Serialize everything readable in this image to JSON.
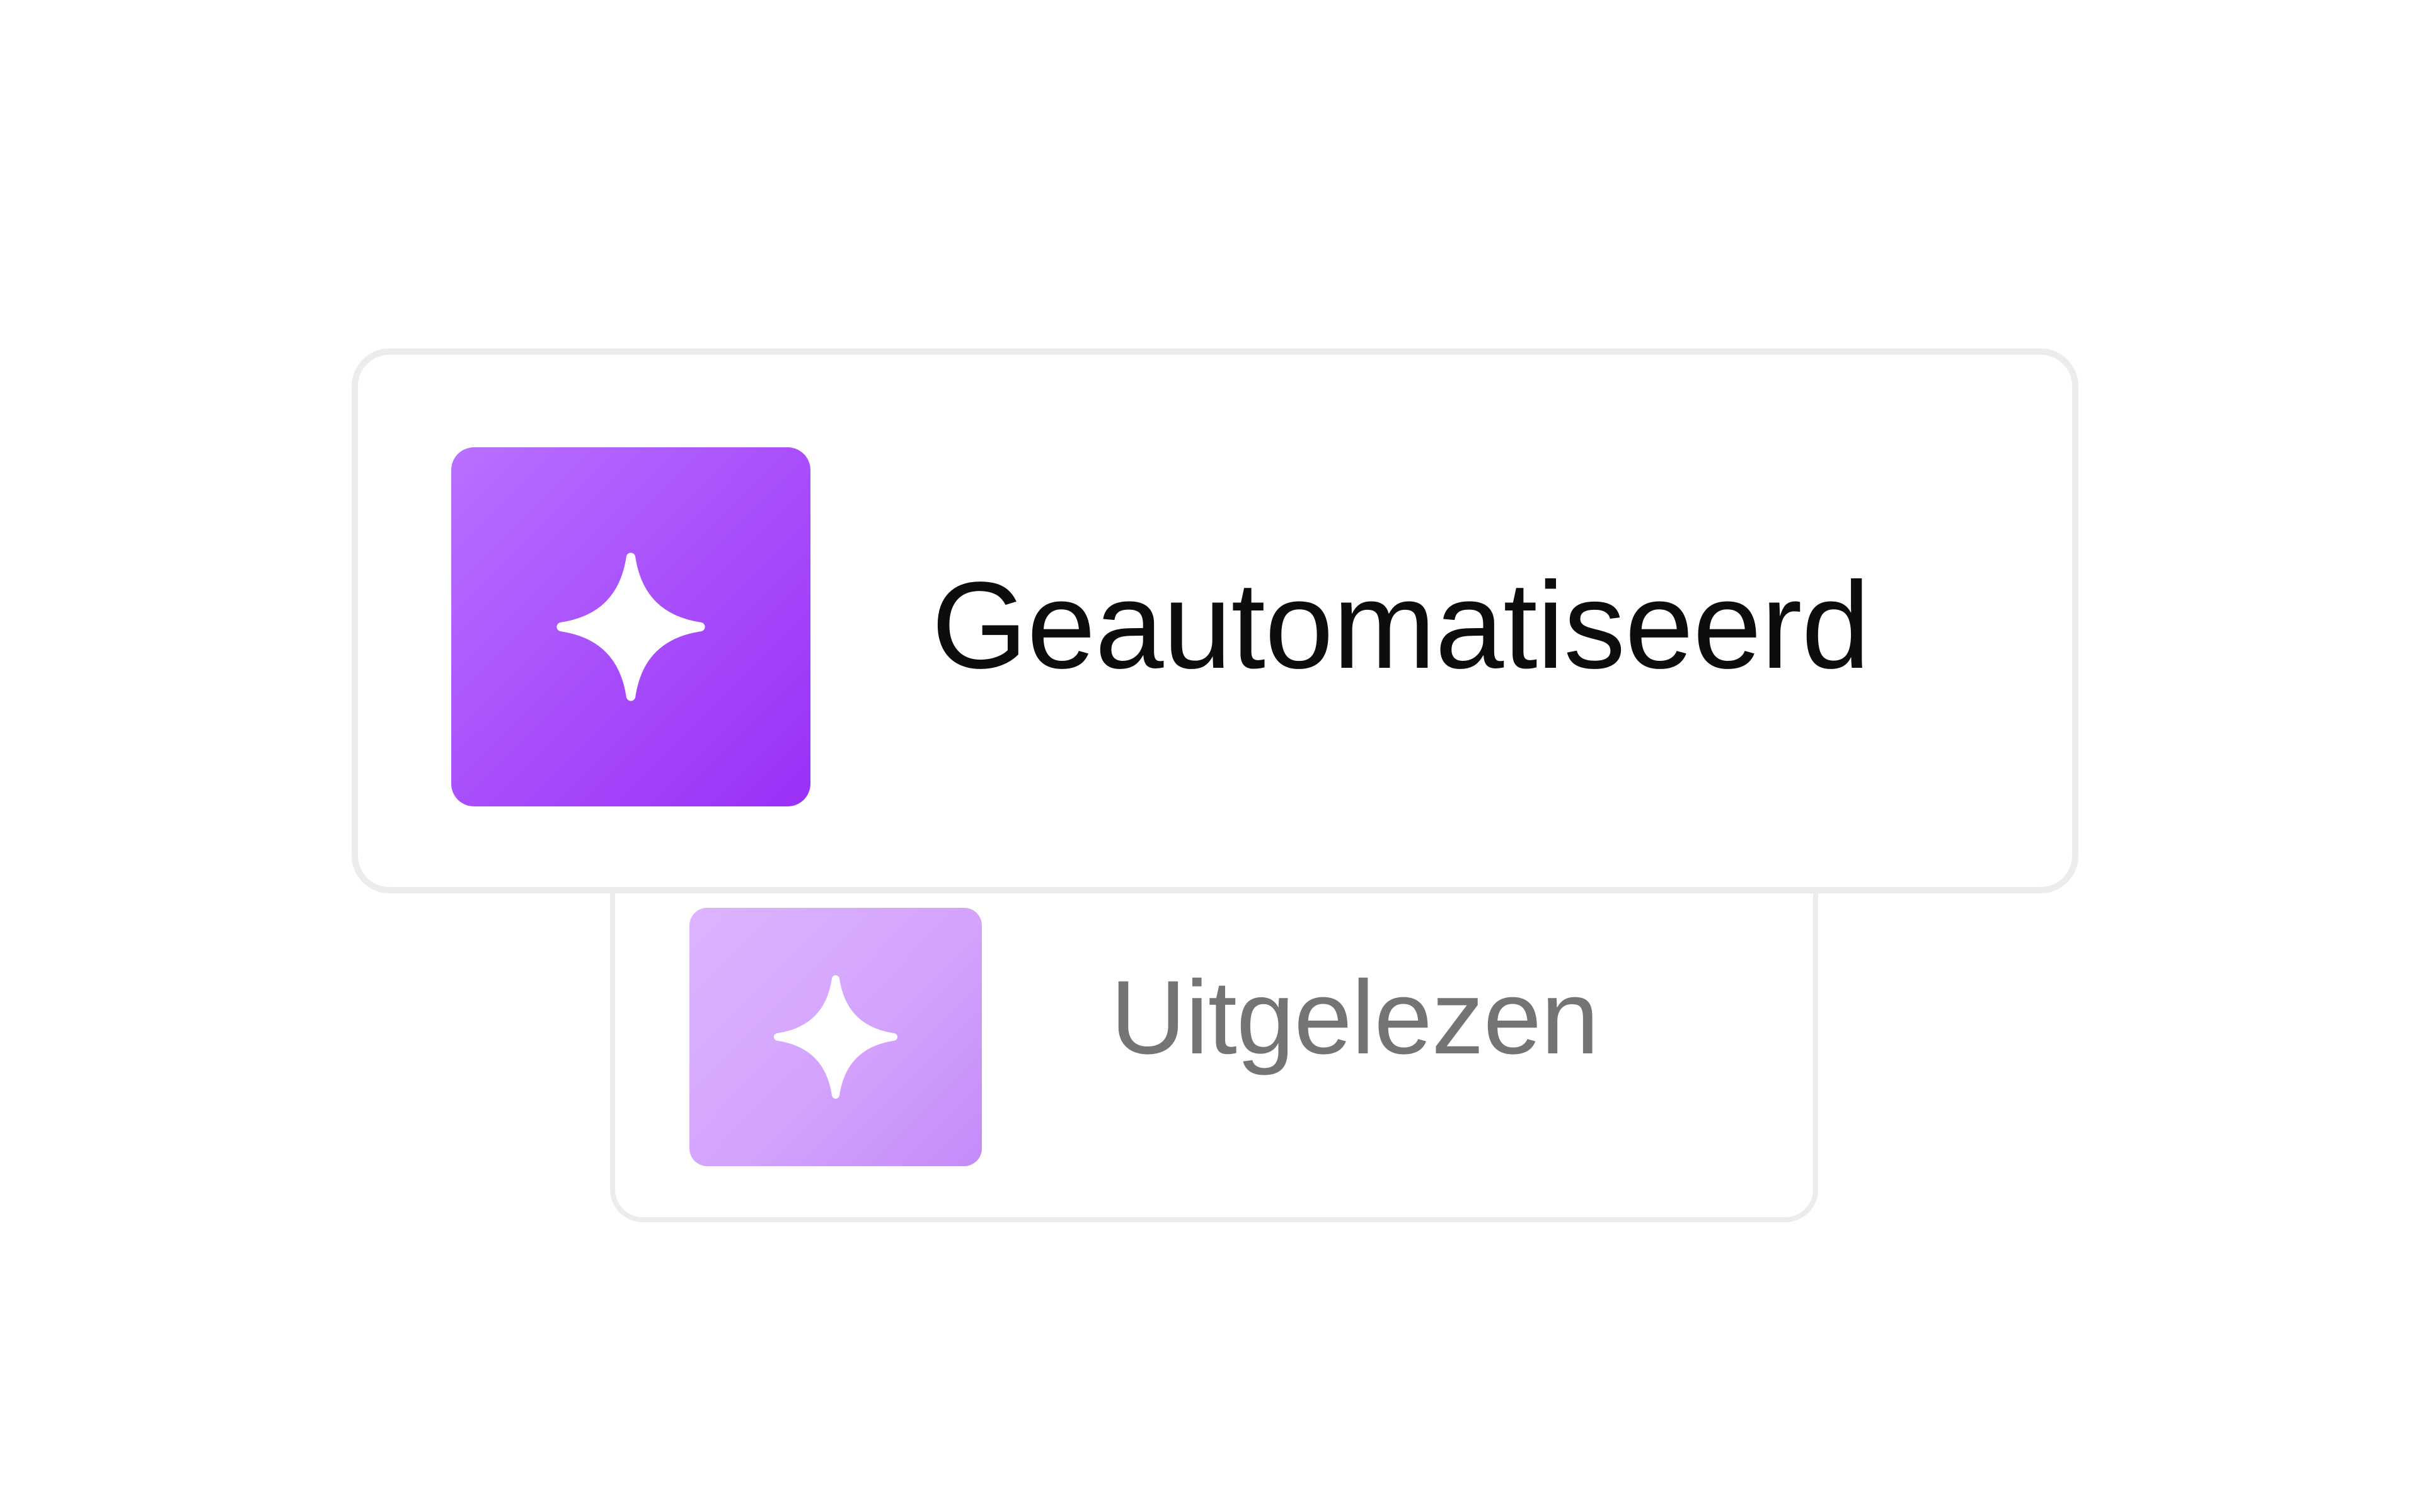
{
  "cards": {
    "primary": {
      "label": "Geautomatiseerd",
      "icon": "sparkle-icon",
      "tile_color": "#a74cfc"
    },
    "secondary": {
      "label": "Uitgelezen",
      "icon": "sparkle-icon",
      "tile_color": "#d3a3fd"
    }
  },
  "colors": {
    "card_border": "#ececec",
    "primary_text": "#0d0d0d",
    "secondary_text": "#747474",
    "background": "#ffffff"
  }
}
